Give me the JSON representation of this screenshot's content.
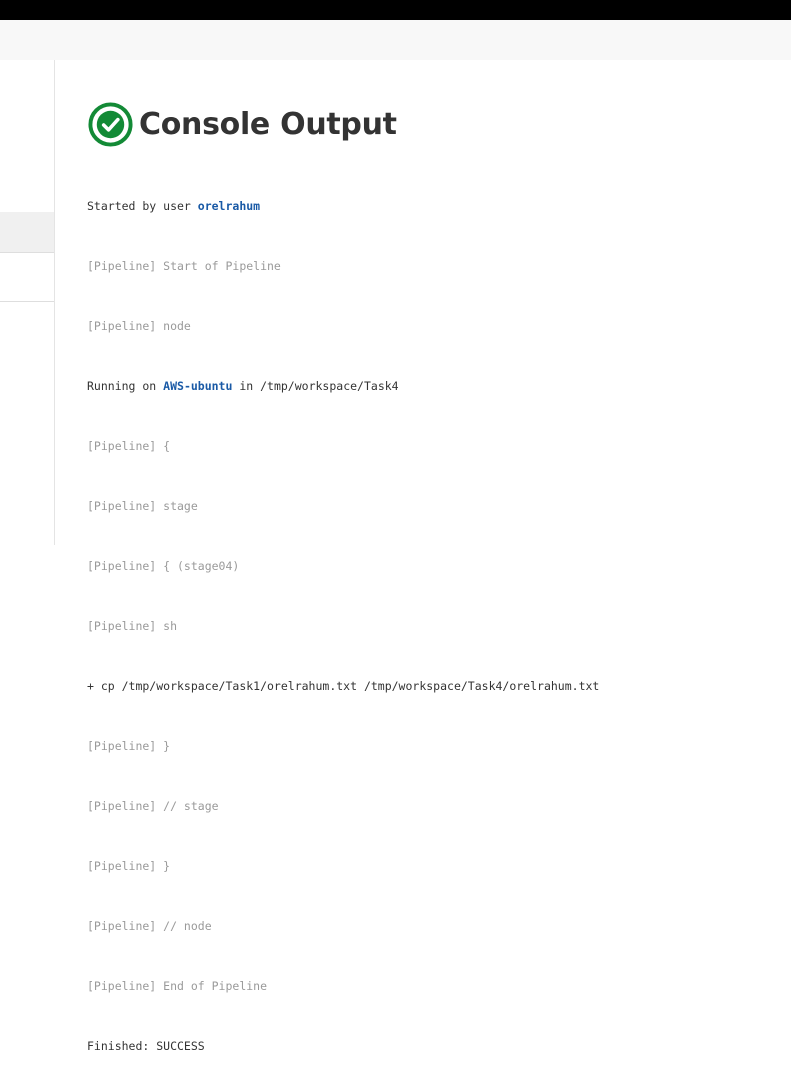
{
  "page": {
    "title": "Console Output",
    "status_icon": "success-check-icon",
    "status_color": "#138a36"
  },
  "console": {
    "started_prefix": "Started by user ",
    "started_user": "orelrahum",
    "lines_block_1": [
      "[Pipeline] Start of Pipeline",
      "[Pipeline] node"
    ],
    "running_prefix": "Running on ",
    "running_node": "AWS-ubuntu",
    "running_suffix": " in /tmp/workspace/Task4",
    "lines_block_2": [
      "[Pipeline] {",
      "[Pipeline] stage",
      "[Pipeline] { (stage04)",
      "[Pipeline] sh"
    ],
    "command": "+ cp /tmp/workspace/Task1/orelrahum.txt /tmp/workspace/Task4/orelrahum.txt",
    "lines_block_3": [
      "[Pipeline] }",
      "[Pipeline] // stage",
      "[Pipeline] }",
      "[Pipeline] // node",
      "[Pipeline] End of Pipeline"
    ],
    "finished": "Finished: SUCCESS"
  }
}
